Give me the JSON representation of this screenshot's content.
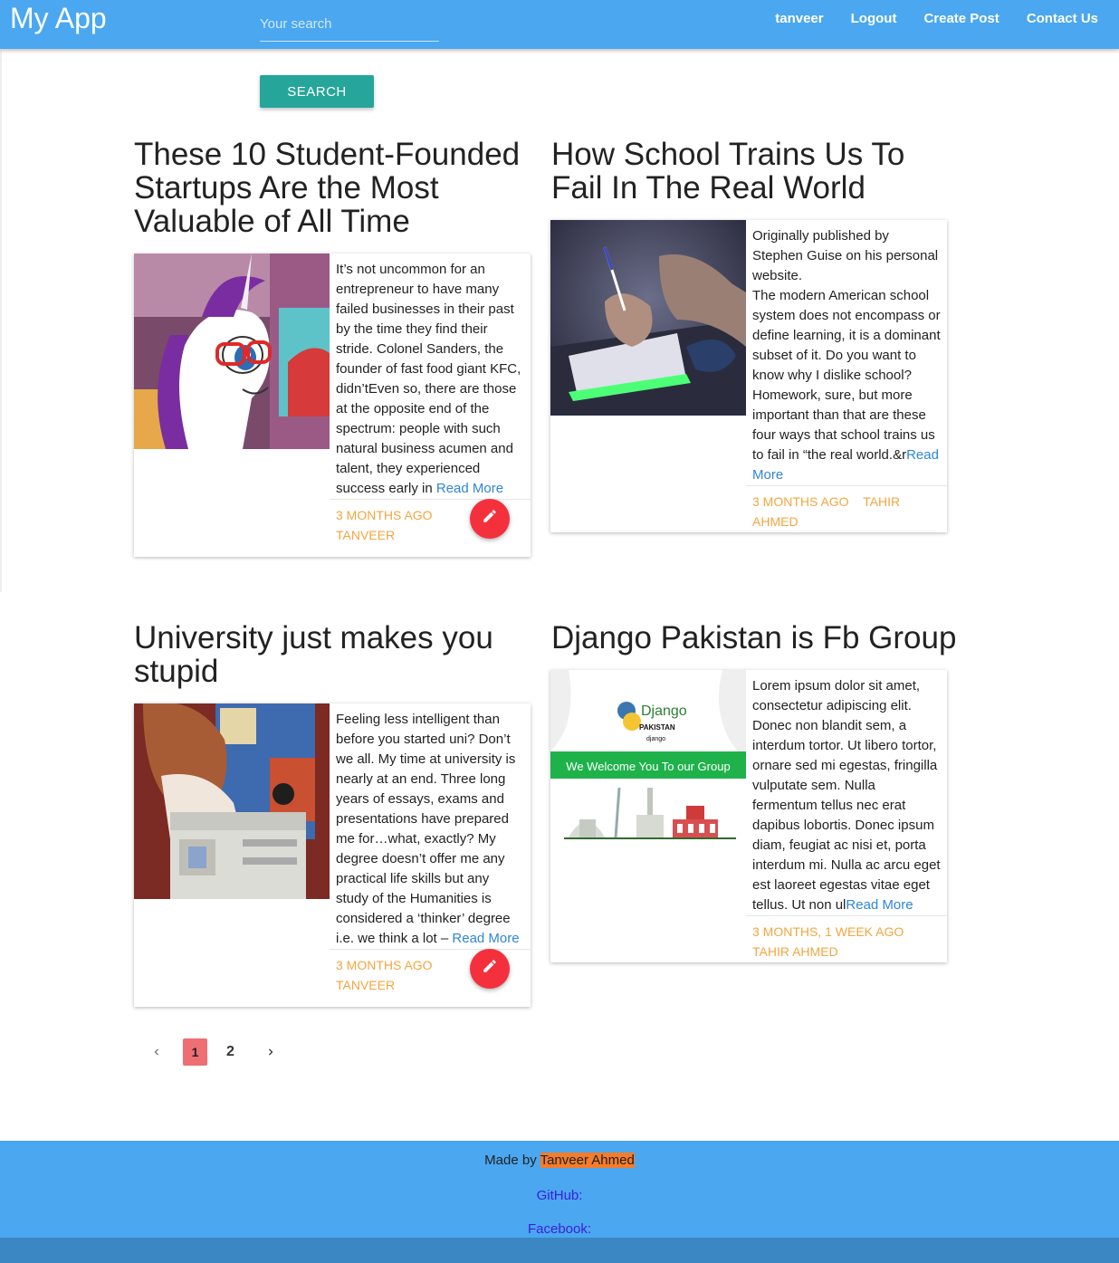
{
  "navbar": {
    "brand": "My App",
    "search_placeholder": "Your search",
    "links": [
      "tanveer",
      "Logout",
      "Create Post",
      "Contact Us"
    ]
  },
  "search": {
    "button_label": "SEARCH"
  },
  "posts": [
    {
      "title": "These 10 Student-Founded Startups Are the Most Valuable of All Time",
      "excerpt": "It’s not uncommon for an entrepreneur to have many failed businesses in their past by the time they find their stride. Colonel Sanders, the founder of fast food giant KFC, didn’tEven so, there are those at the opposite end of the spectrum: people with such natural business acumen and talent, they experienced success early in ",
      "read_more": "Read More",
      "time": "3 months ago",
      "author": "tanveer",
      "editable": true
    },
    {
      "title": "How School Trains Us To Fail In The Real World",
      "excerpt": "Originally published by Stephen Guise on his personal website.\nThe modern American school system does not encompass or define learning, it is a dominant subset of it. Do you want to know why I dislike school? Homework, sure, but more important than that are these four ways that school trains us to fail in “the real world.&r",
      "read_more": "Read More",
      "time": "3 months ago",
      "author": "tahir ahmed",
      "editable": false
    },
    {
      "title": "University just makes you stupid",
      "excerpt": "Feeling less intelligent than before you started uni? Don’t we all. My time at university is nearly at an end. Three long years of essays, exams and presentations have prepared me for…what, exactly? My degree doesn’t offer me any practical life skills but any study of the Humanities is considered a ‘thinker’ degree i.e. we think a lot – ",
      "read_more": "Read More",
      "time": "3 months ago",
      "author": "tanveer",
      "editable": true
    },
    {
      "title": "Django Pakistan is Fb Group",
      "excerpt": "Lorem ipsum dolor sit amet, consectetur adipiscing elit. Donec non blandit sem, a interdum tortor. Ut libero tortor, ornare sed mi egestas, fringilla vulputate sem. Nulla fermentum tellus nec erat dapibus lobortis. Donec ipsum diam, feugiat ac nisi et, porta interdum mi. Nulla ac arcu eget est laoreet egestas vitae eget tellus. Ut non ul",
      "read_more": "Read More",
      "time": "3 months, 1 week ago",
      "author": "tahir ahmed",
      "editable": false,
      "image_text": {
        "logo": "Django",
        "sub1": "PAKISTAN",
        "sub2": "django",
        "banner": "We Welcome You To our Group"
      }
    }
  ],
  "pagination": {
    "pages": [
      "1",
      "2"
    ],
    "current": "1"
  },
  "footer": {
    "made_by": "Made by ",
    "name": "Tanveer Ahmed",
    "github": "GitHub:",
    "facebook": "Facebook:"
  }
}
